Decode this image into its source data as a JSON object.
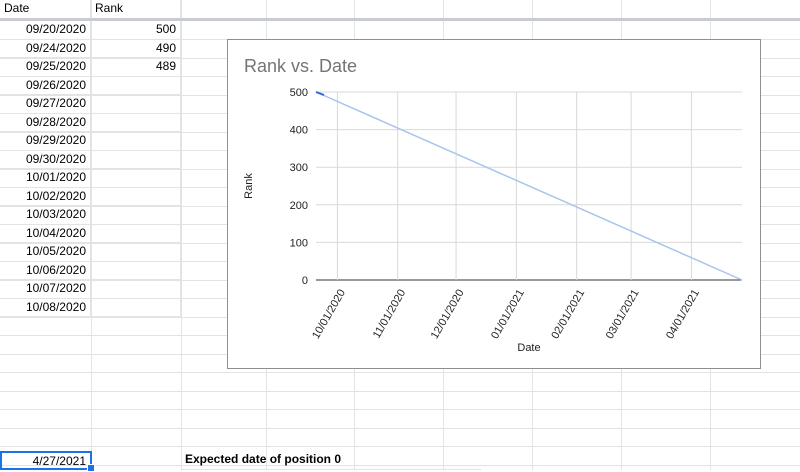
{
  "headers": {
    "date": "Date",
    "rank": "Rank"
  },
  "rows": [
    {
      "date": "09/20/2020",
      "rank": "500"
    },
    {
      "date": "09/24/2020",
      "rank": "490"
    },
    {
      "date": "09/25/2020",
      "rank": "489"
    },
    {
      "date": "09/26/2020",
      "rank": ""
    },
    {
      "date": "09/27/2020",
      "rank": ""
    },
    {
      "date": "09/28/2020",
      "rank": ""
    },
    {
      "date": "09/29/2020",
      "rank": ""
    },
    {
      "date": "09/30/2020",
      "rank": ""
    },
    {
      "date": "10/01/2020",
      "rank": ""
    },
    {
      "date": "10/02/2020",
      "rank": ""
    },
    {
      "date": "10/03/2020",
      "rank": ""
    },
    {
      "date": "10/04/2020",
      "rank": ""
    },
    {
      "date": "10/05/2020",
      "rank": ""
    },
    {
      "date": "10/06/2020",
      "rank": ""
    },
    {
      "date": "10/07/2020",
      "rank": ""
    },
    {
      "date": "10/08/2020",
      "rank": ""
    }
  ],
  "bottom": {
    "selected_value": "4/27/2021",
    "expected_label": "Expected date of position 0"
  },
  "colors": {
    "selection": "#1a73e8",
    "series_line": "#a8c4ef",
    "series_start": "#3367d6",
    "grid": "#d9d9d9",
    "axis": "#333333"
  },
  "chart_data": {
    "type": "line",
    "title": "Rank vs. Date",
    "xlabel": "Date",
    "ylabel": "Rank",
    "ylim": [
      0,
      500
    ],
    "yticks": [
      0,
      100,
      200,
      300,
      400,
      500
    ],
    "xlim": [
      "09/20/2020",
      "04/27/2021"
    ],
    "xticks": [
      "10/01/2020",
      "11/01/2020",
      "12/01/2020",
      "01/01/2021",
      "02/01/2021",
      "03/01/2021",
      "04/01/2021"
    ],
    "grid": true,
    "legend": "none",
    "series": [
      {
        "points": [
          {
            "x": "09/20/2020",
            "y": 500
          },
          {
            "x": "04/27/2021",
            "y": 0
          }
        ]
      }
    ]
  }
}
